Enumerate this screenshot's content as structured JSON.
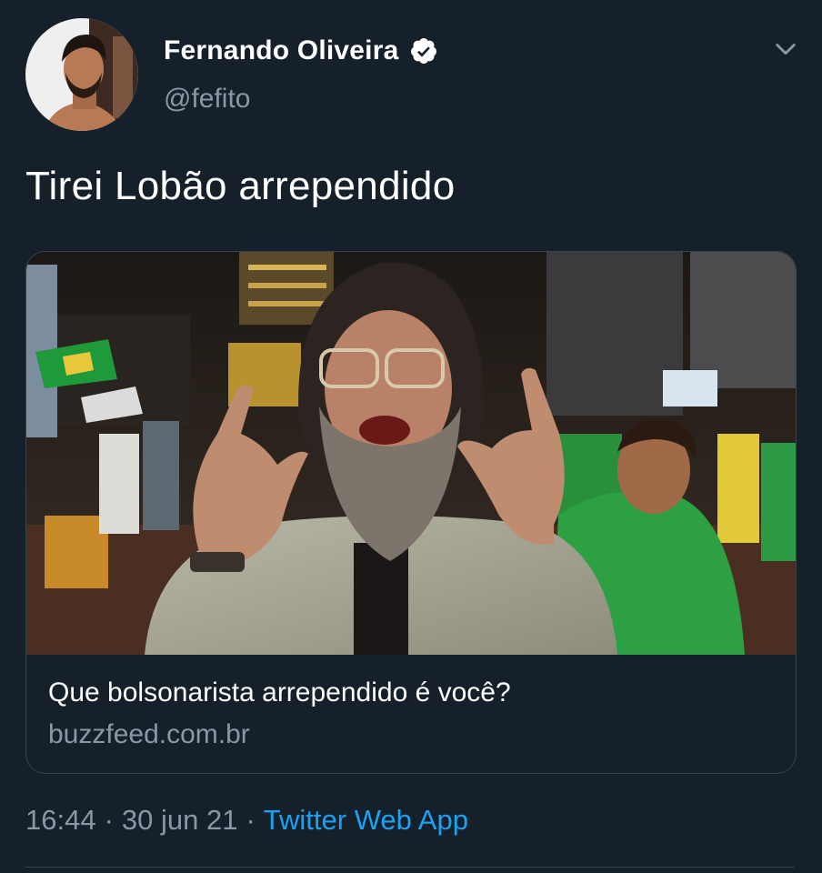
{
  "author": {
    "display_name": "Fernando Oliveira",
    "handle": "@fefito",
    "verified": true,
    "avatar_icon": "profile-photo"
  },
  "tweet": {
    "text": "Tirei Lobão arrependido",
    "time": "16:44",
    "date": "30 jun 21",
    "separator": "·",
    "source": "Twitter Web App"
  },
  "card": {
    "title": "Que bolsonarista arrependido é você?",
    "domain": "buzzfeed.com.br",
    "image_icon": "link-preview-photo"
  },
  "icons": {
    "more": "chevron-down-icon",
    "verified": "verified-badge-icon"
  },
  "colors": {
    "background": "#15202b",
    "primary_text": "#ffffff",
    "secondary_text": "#8899a6",
    "link": "#1da1f2",
    "border": "#38444d",
    "verified_badge": "#ffffff"
  }
}
